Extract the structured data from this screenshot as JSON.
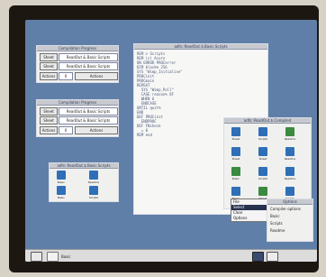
{
  "windows": {
    "top_left": {
      "title": "Compilation Progress",
      "row1": {
        "btn": "Sheet",
        "field": "ReadOut & Basic Scripts"
      },
      "row2": {
        "btn": "Sheet",
        "field": "ReadOut & Basic Scripts"
      },
      "row3": {
        "btn": "Actions",
        "value": "0",
        "btn2": "Actions"
      }
    },
    "mid_left": {
      "title": "Compilation Progress",
      "row1": {
        "btn": "Sheet",
        "field": "ReadOut & Basic Scripts"
      },
      "row2": {
        "btn": "Sheet",
        "field": "ReadOut & Basic Scripts"
      },
      "row3": {
        "btn": "Actions",
        "value": "0",
        "btn2": "Actions"
      }
    },
    "filer_small": {
      "title": "adfs::ReadOut.$.Basic.Scripts",
      "icons": [
        "Basic",
        "Readme",
        "Basic",
        "Scripts"
      ]
    },
    "editor": {
      "title": "adfs::ReadOut.$.Basic.Scripts",
      "lines": [
        "REM > Scripts",
        "REM (c) Acorn",
        "",
        "ON ERROR PROCerror",
        "DIM block% 256",
        "SYS \"Wimp_Initialise\"",
        "PROCinit",
        "PROCmain",
        "REPEAT",
        "  SYS \"Wimp_Poll\"",
        "  CASE reason% OF",
        "  WHEN 6",
        "  ENDCASE",
        "",
        "UNTIL quit%",
        "END",
        "",
        "DEF PROCinit",
        "  ENDPROC",
        "",
        "DEF FNcheck",
        "  = 0",
        "",
        "REM end"
      ]
    },
    "filer_big": {
      "title": "adfs::ReadOut.$.Compiled",
      "icons": [
        "Sheet",
        "Scripts",
        "Readme",
        "Sheet",
        "Sheet",
        "Readme",
        "Basic",
        "Scripts",
        "Readme",
        "Basic",
        "Sheet",
        "Scripts"
      ]
    },
    "menu": {
      "items": [
        "File",
        "Select",
        "Clear",
        "Options"
      ]
    },
    "options_dialog": {
      "title": "Options",
      "rows": [
        "Compiler options",
        "Basic",
        "Scripts",
        "Readme"
      ]
    }
  },
  "iconbar": {
    "left_icons": [
      "drive-icon",
      "ram-icon"
    ],
    "left_label": "Basic",
    "right_icons": [
      "app-icon",
      "task-manager-icon"
    ]
  },
  "colors": {
    "desktop": "#5f7fa8",
    "bezel": "#1d1712",
    "window_bg": "#f0f0ee",
    "titlebar": "#c7c9cf",
    "icon_blue": "#2f6fb8",
    "icon_green": "#3a8a3f"
  }
}
